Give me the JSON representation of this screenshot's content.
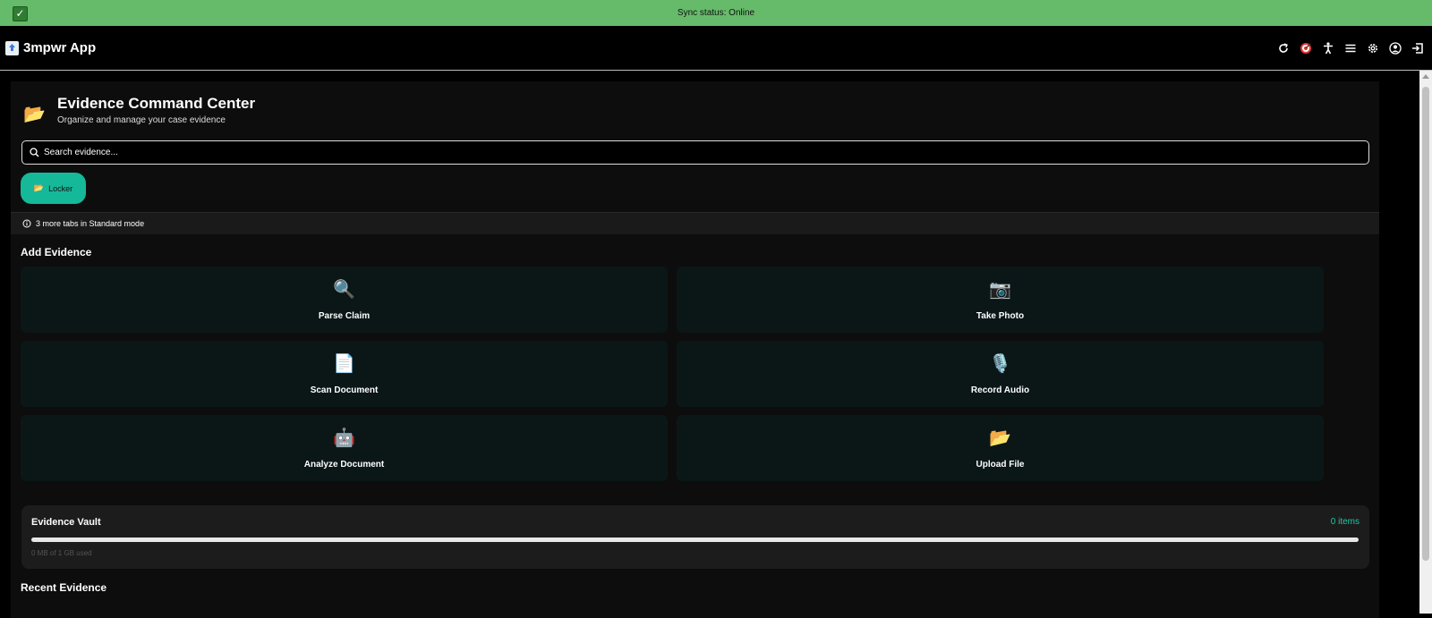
{
  "sync": {
    "status_text": "Sync status: Online"
  },
  "topbar": {
    "app_title": "3mpwr App",
    "icons": [
      "refresh-icon",
      "target-icon",
      "accessibility-icon",
      "menu-icon",
      "gear-icon",
      "account-icon",
      "logout-icon"
    ]
  },
  "header": {
    "icon": "📂",
    "title": "Evidence Command Center",
    "subtitle": "Organize and manage your case evidence"
  },
  "search": {
    "placeholder": "Search evidence..."
  },
  "tabs": [
    {
      "label": "Locker",
      "icon": "📂",
      "active": true
    }
  ],
  "more_tabs": {
    "text": "3 more tabs in Standard mode"
  },
  "add_evidence": {
    "title": "Add Evidence",
    "actions": [
      {
        "label": "Parse Claim",
        "icon": "🔍"
      },
      {
        "label": "Take Photo",
        "icon": "📷"
      },
      {
        "label": "Scan Document",
        "icon": "📄"
      },
      {
        "label": "Record Audio",
        "icon": "🎙️"
      },
      {
        "label": "Analyze Document",
        "icon": "🤖"
      },
      {
        "label": "Upload File",
        "icon": "📂"
      }
    ]
  },
  "vault": {
    "title": "Evidence Vault",
    "count": "0 items",
    "usage": "0 MB of 1 GB used",
    "used_fraction": 0
  },
  "recent": {
    "title": "Recent Evidence"
  },
  "colors": {
    "accent": "#1ec8a5",
    "sync_bar": "#66bb6a",
    "tile_bg": "#0b1717"
  }
}
